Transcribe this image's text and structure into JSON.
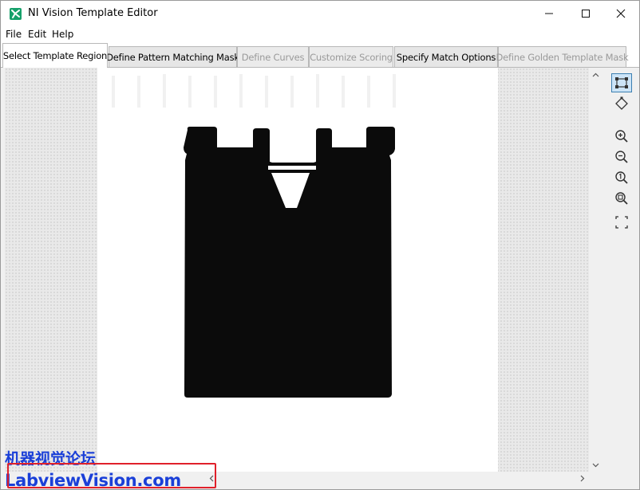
{
  "window": {
    "title": "NI Vision Template Editor"
  },
  "menu": [
    "File",
    "Edit",
    "Help"
  ],
  "tabs": [
    {
      "label": "Select Template Region",
      "state": "active"
    },
    {
      "label": "Define Pattern Matching Mask",
      "state": "enabled"
    },
    {
      "label": "Define Curves",
      "state": "disabled"
    },
    {
      "label": "Customize Scoring",
      "state": "disabled"
    },
    {
      "label": "Specify Match Options",
      "state": "enabled"
    },
    {
      "label": "Define Golden Template Mask",
      "state": "disabled"
    }
  ],
  "toolbar": {
    "tools": [
      {
        "icon": "rectangle-select-icon",
        "selected": true
      },
      {
        "icon": "rotated-rectangle-icon",
        "selected": false
      },
      {
        "icon": "zoom-in-icon",
        "selected": false
      },
      {
        "icon": "zoom-out-icon",
        "selected": false
      },
      {
        "icon": "zoom-1to1-icon",
        "selected": false
      },
      {
        "icon": "zoom-fit-icon",
        "selected": false
      },
      {
        "icon": "fit-to-window-icon",
        "selected": false
      }
    ]
  },
  "watermark": {
    "chinese": "机器视觉论坛",
    "english": "LabviewVision.com",
    "color": "#1a3fd8",
    "box_color": "#e0202a"
  },
  "colors": {
    "app_icon": "#16a06a",
    "selected_tool": "#cce4f7"
  }
}
